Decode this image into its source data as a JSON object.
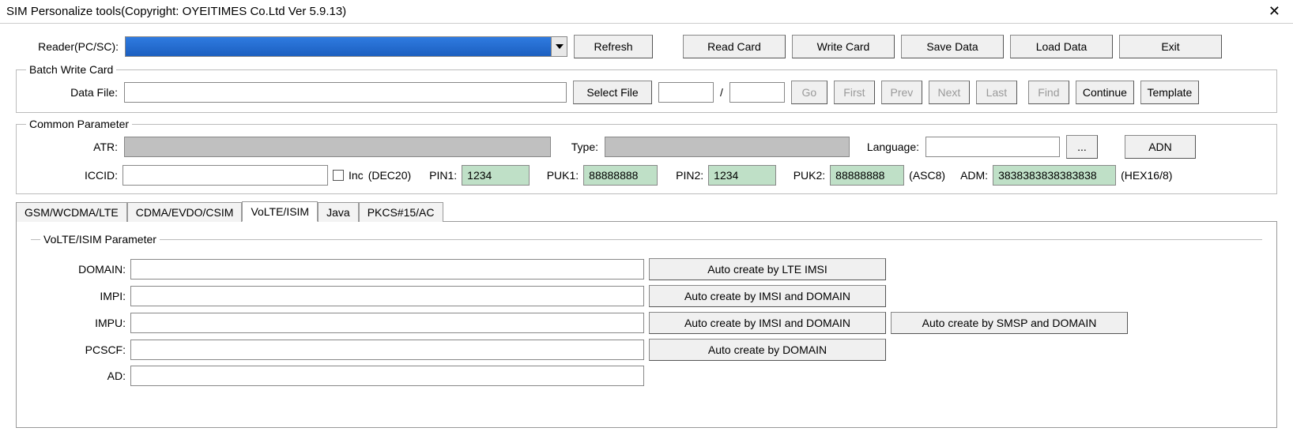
{
  "window": {
    "title": "SIM Personalize tools(Copyright: OYEITIMES Co.Ltd   Ver 5.9.13)"
  },
  "top": {
    "reader_label": "Reader(PC/SC):",
    "refresh": "Refresh",
    "read_card": "Read Card",
    "write_card": "Write Card",
    "save_data": "Save Data",
    "load_data": "Load Data",
    "exit": "Exit"
  },
  "batch": {
    "legend": "Batch Write Card",
    "data_file_label": "Data File:",
    "data_file_value": "",
    "select_file": "Select File",
    "range_from": "",
    "range_sep": "/",
    "range_to": "",
    "go": "Go",
    "first": "First",
    "prev": "Prev",
    "next": "Next",
    "last": "Last",
    "find": "Find",
    "continue": "Continue",
    "template": "Template"
  },
  "common": {
    "legend": "Common Parameter",
    "atr_label": "ATR:",
    "atr_value": "",
    "type_label": "Type:",
    "type_value": "",
    "language_label": "Language:",
    "language_value": "",
    "language_browse": "...",
    "adn": "ADN",
    "iccid_label": "ICCID:",
    "iccid_value": "",
    "inc_label": "Inc",
    "dec20": "(DEC20)",
    "pin1_label": "PIN1:",
    "pin1_value": "1234",
    "puk1_label": "PUK1:",
    "puk1_value": "88888888",
    "pin2_label": "PIN2:",
    "pin2_value": "1234",
    "puk2_label": "PUK2:",
    "puk2_value": "88888888",
    "asc8": "(ASC8)",
    "adm_label": "ADM:",
    "adm_value": "3838383838383838",
    "hex168": "(HEX16/8)"
  },
  "tabs": {
    "t0": "GSM/WCDMA/LTE",
    "t1": "CDMA/EVDO/CSIM",
    "t2": "VoLTE/ISIM",
    "t3": "Java",
    "t4": "PKCS#15/AC"
  },
  "volte": {
    "legend": "VoLTE/ISIM  Parameter",
    "domain_label": "DOMAIN:",
    "domain_value": "",
    "impi_label": "IMPI:",
    "impi_value": "",
    "impu_label": "IMPU:",
    "impu_value": "",
    "pcscf_label": "PCSCF:",
    "pcscf_value": "",
    "ad_label": "AD:",
    "ad_value": "",
    "btn_domain": "Auto create by LTE IMSI",
    "btn_impi": "Auto create by IMSI and DOMAIN",
    "btn_impu1": "Auto create by IMSI and DOMAIN",
    "btn_impu2": "Auto create by SMSP and DOMAIN",
    "btn_pcscf": "Auto create by DOMAIN"
  }
}
